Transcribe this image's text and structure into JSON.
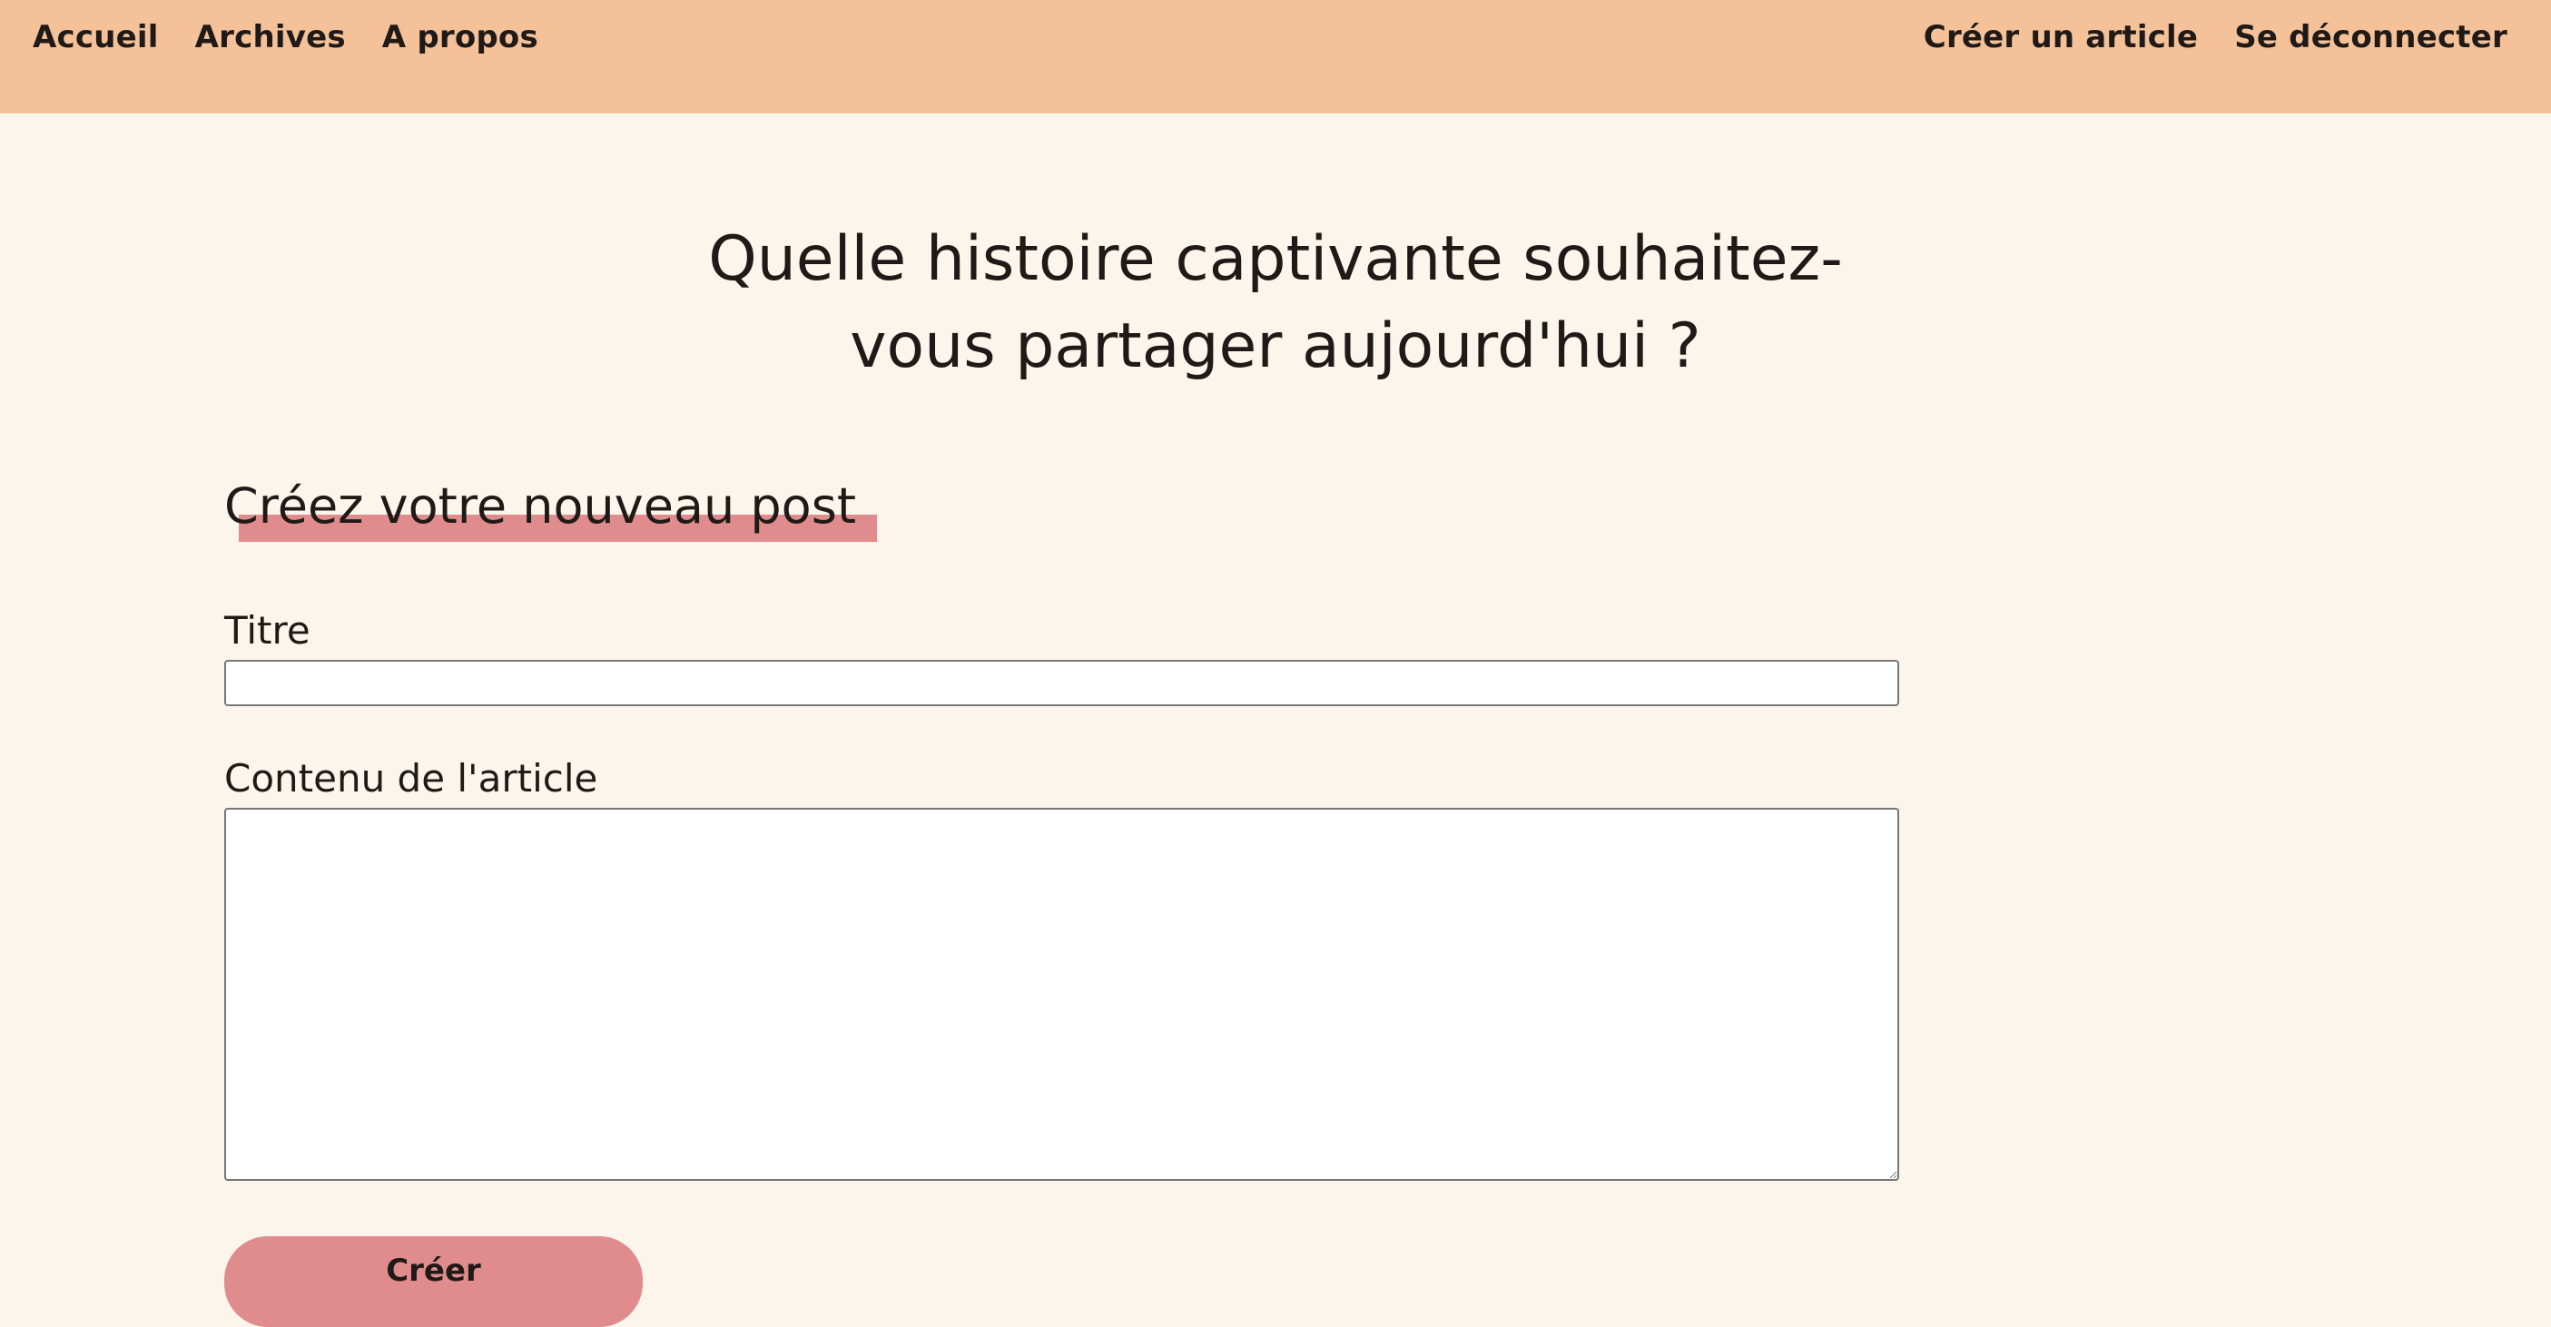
{
  "nav": {
    "left_items": [
      {
        "label": "Accueil"
      },
      {
        "label": "Archives"
      },
      {
        "label": "A propos"
      }
    ],
    "right_items": [
      {
        "label": "Créer un article"
      },
      {
        "label": "Se déconnecter"
      }
    ]
  },
  "hero": {
    "title": "Quelle histoire captivante souhaitez-vous partager aujourd'hui ?"
  },
  "form": {
    "section_title": "Créez votre nouveau post",
    "title_label": "Titre",
    "title_value": "",
    "title_placeholder": "",
    "content_label": "Contenu de l'article",
    "content_value": "",
    "content_placeholder": "",
    "submit_label": "Créer"
  },
  "colors": {
    "header_background": "#f4c198",
    "page_background": "#fcf5eb",
    "accent": "#e08c8c",
    "text": "#1f1a17"
  }
}
